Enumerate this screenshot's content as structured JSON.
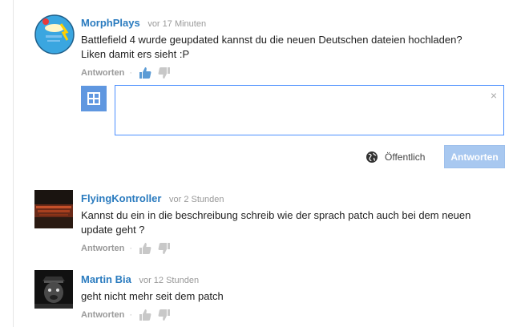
{
  "comments": [
    {
      "author": "MorphPlays",
      "time": "vor 17 Minuten",
      "text_line1": "Battlefield 4 wurde geupdated kannst du die neuen Deutschen dateien hochladen?",
      "text_line2": "Liken damit ers sieht :P",
      "reply_label": "Antworten",
      "like_icon": "thumbs-up-icon",
      "dislike_icon": "thumbs-down-icon",
      "like_active": true
    },
    {
      "author": "FlyingKontroller",
      "time": "vor 2 Stunden",
      "text_line1": "Kannst du ein in die beschreibung schreib wie der sprach patch auch bei dem neuen",
      "text_line2": "update geht ?",
      "reply_label": "Antworten",
      "like_icon": "thumbs-up-icon",
      "dislike_icon": "thumbs-down-icon",
      "like_active": false
    },
    {
      "author": "Martin Bia",
      "time": "vor 12 Stunden",
      "text_line1": "geht nicht mehr seit dem patch",
      "reply_label": "Antworten",
      "like_icon": "thumbs-up-icon",
      "dislike_icon": "thumbs-down-icon",
      "like_active": false
    }
  ],
  "reply_box": {
    "input_value": "",
    "close_symbol": "×",
    "visibility_label": "Öffentlich",
    "submit_label": "Antworten"
  },
  "colors": {
    "author": "#2a7bbf",
    "like_active": "#5b9bd5",
    "icon_inactive": "#c8c8c8",
    "button_disabled": "#a8c8f0",
    "input_border": "#4d90fe"
  }
}
